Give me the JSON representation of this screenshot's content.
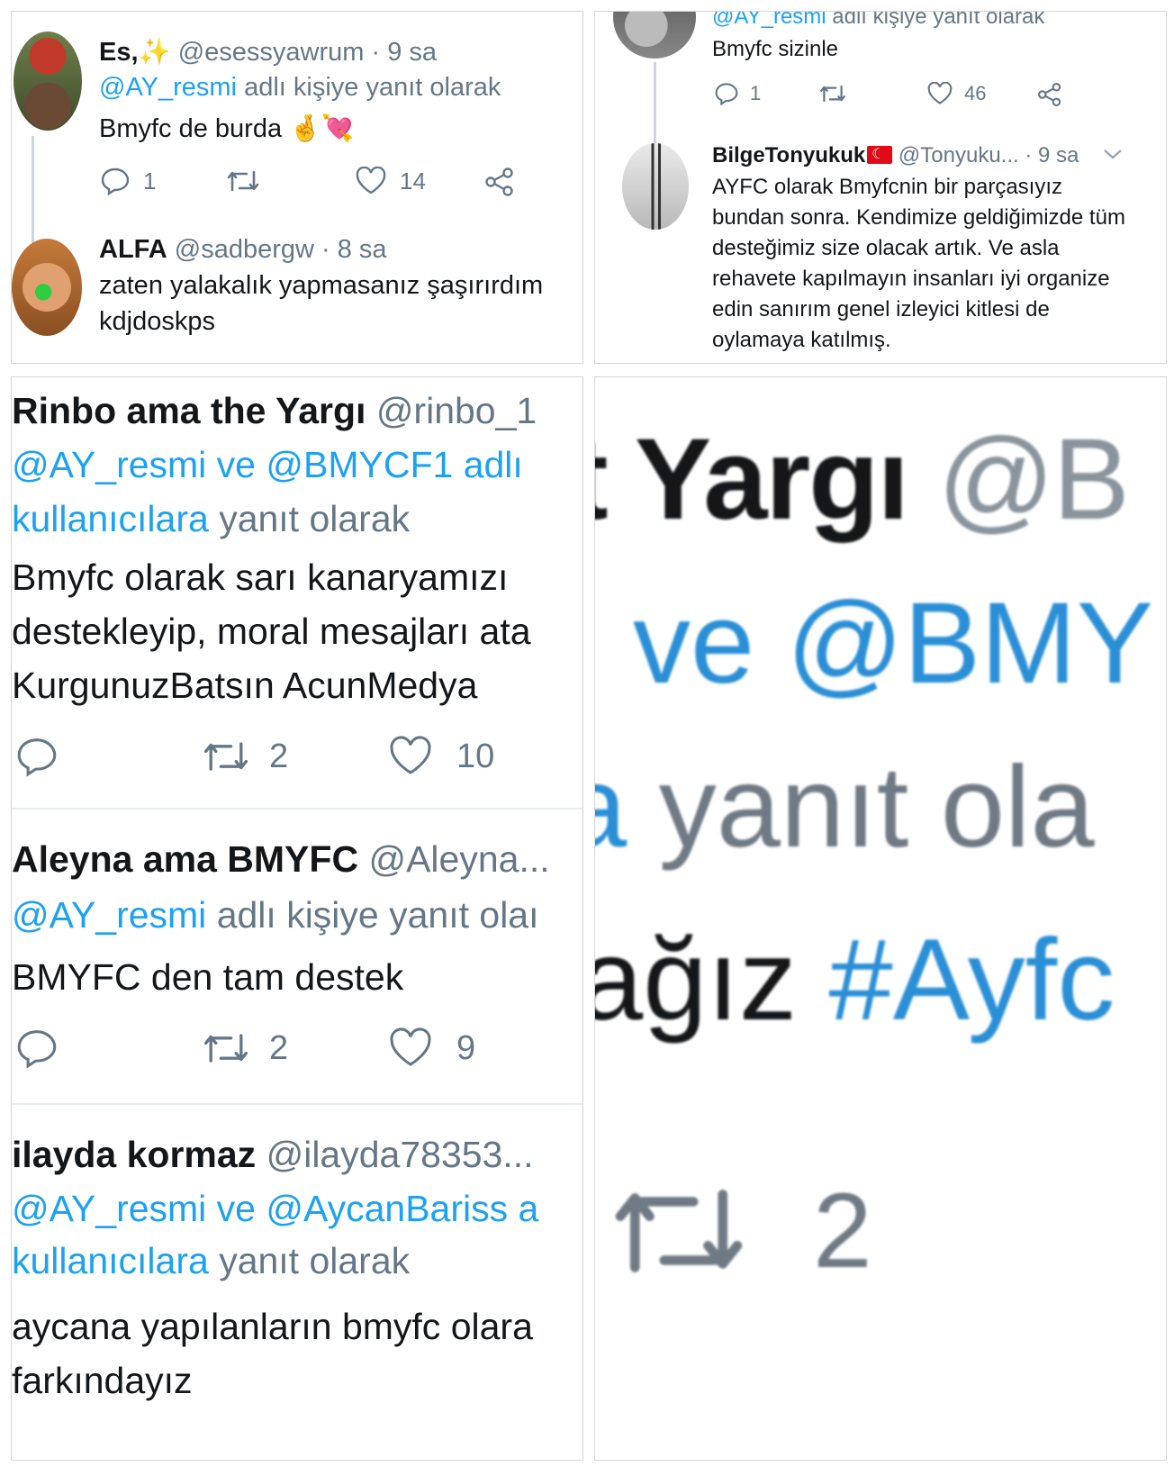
{
  "panel1": {
    "tweet1": {
      "name": "Es,✨",
      "handle": "@esessyawrum",
      "time": "· 9 sa",
      "reply_mention": "@AY_resmi",
      "reply_suffix": "adlı kişiye yanıt olarak",
      "text": "Bmyfc de burda 🤞💘",
      "replies": "1",
      "retweets": "",
      "likes": "14"
    },
    "tweet2": {
      "name": "ALFA",
      "handle": "@sadbergw",
      "time": "· 8 sa",
      "text_line1": "zaten yalakalık yapmasanız şaşırırdım",
      "text_line2": "kdjdoskps"
    }
  },
  "panel2": {
    "tweet1": {
      "reply_mention": "@AY_resmi",
      "reply_suffix": "adlı kişiye yanıt olarak",
      "text": "Bmyfc sizinle",
      "replies": "1",
      "likes": "46"
    },
    "tweet2": {
      "name": "BilgeTonyukuk",
      "handle": "@Tonyuku...",
      "time": "· 9 sa",
      "text": "AYFC olarak Bmyfcnin bir parçasıyız bundan sonra. Kendimize geldiğimizde tüm desteğimiz size olacak artık. Ve asla rehavete kapılmayın insanları iyi organize edin sanırım genel izleyici kitlesi de oylamaya katılmış."
    }
  },
  "panel3": {
    "tweet1": {
      "name": "Rinbo ama the Yargı",
      "handle": "@rinbo_1",
      "reply_mentions": "@AY_resmi ve @BMYCF1 adlı",
      "reply_line2_link": "kullanıcılara",
      "reply_line2_suffix": "yanıt olarak",
      "text_line1": "Bmyfc olarak sarı kanaryamızı",
      "text_line2": "destekleyip, moral mesajları ata",
      "text_line3": "KurgunuzBatsın AcunMedya",
      "retweets": "2",
      "likes": "10"
    },
    "tweet2": {
      "name": "Aleyna ama BMYFC",
      "handle": "@Aleyna...",
      "reply_mention": "@AY_resmi",
      "reply_suffix": "adlı kişiye yanıt olaı",
      "text": "BMYFC den tam destek",
      "retweets": "2",
      "likes": "9"
    },
    "tweet3": {
      "name": "ilayda kormaz",
      "handle": "@ilayda78353...",
      "reply_mentions": "@AY_resmi ve @AycanBariss a",
      "reply_line2_link": "kullanıcılara",
      "reply_line2_suffix": "yanıt olarak",
      "text_line1": "aycana yapılanların bmyfc olara",
      "text_line2": "farkındayız"
    }
  },
  "panel4": {
    "line1_name": "t Yargı",
    "line1_handle": "@B",
    "line2": "i ve @BMY",
    "line3_link": "a",
    "line3_rest": "yanıt ola",
    "line4_text": "ağız",
    "line4_hashtag": "#Ayfc",
    "retweets": "2"
  },
  "colors": {
    "link": "#1da1f2",
    "muted": "#657786",
    "text": "#14171a",
    "flag": "#e30a17"
  }
}
